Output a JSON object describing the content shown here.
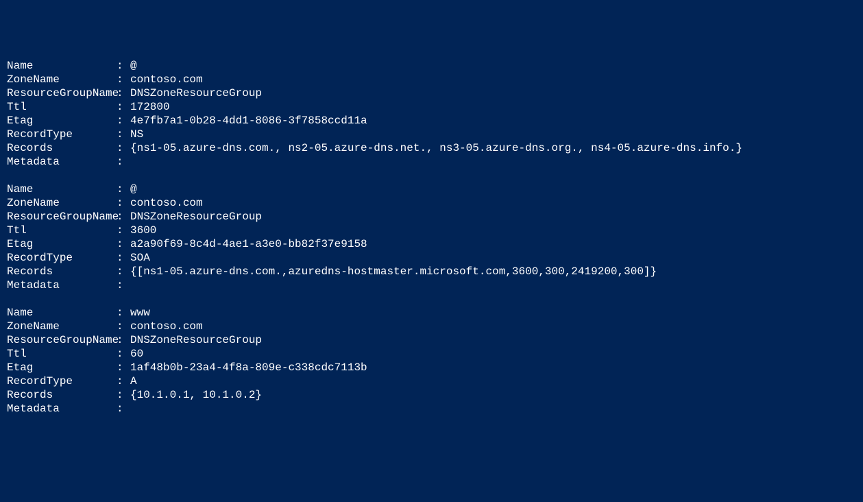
{
  "labels": {
    "Name": "Name",
    "ZoneName": "ZoneName",
    "ResourceGroupName": "ResourceGroupName",
    "Ttl": "Ttl",
    "Etag": "Etag",
    "RecordType": "RecordType",
    "Records": "Records",
    "Metadata": "Metadata"
  },
  "sep": ":",
  "records": [
    {
      "Name": "@",
      "ZoneName": "contoso.com",
      "ResourceGroupName": "DNSZoneResourceGroup",
      "Ttl": "172800",
      "Etag": "4e7fb7a1-0b28-4dd1-8086-3f7858ccd11a",
      "RecordType": "NS",
      "Records": "{ns1-05.azure-dns.com., ns2-05.azure-dns.net., ns3-05.azure-dns.org., ns4-05.azure-dns.info.}",
      "Metadata": ""
    },
    {
      "Name": "@",
      "ZoneName": "contoso.com",
      "ResourceGroupName": "DNSZoneResourceGroup",
      "Ttl": "3600",
      "Etag": "a2a90f69-8c4d-4ae1-a3e0-bb82f37e9158",
      "RecordType": "SOA",
      "Records": "{[ns1-05.azure-dns.com.,azuredns-hostmaster.microsoft.com,3600,300,2419200,300]}",
      "Metadata": ""
    },
    {
      "Name": "www",
      "ZoneName": "contoso.com",
      "ResourceGroupName": "DNSZoneResourceGroup",
      "Ttl": "60",
      "Etag": "1af48b0b-23a4-4f8a-809e-c338cdc7113b",
      "RecordType": "A",
      "Records": "{10.1.0.1, 10.1.0.2}",
      "Metadata": ""
    }
  ]
}
